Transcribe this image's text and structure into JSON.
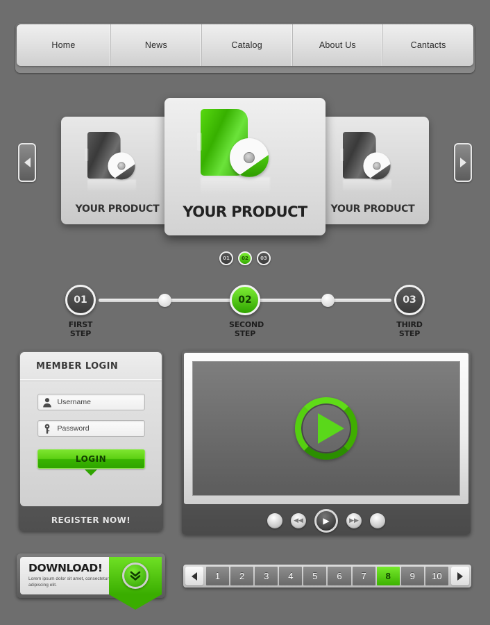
{
  "nav": {
    "items": [
      {
        "label": "Home",
        "active": true
      },
      {
        "label": "News",
        "active": false
      },
      {
        "label": "Catalog",
        "active": false
      },
      {
        "label": "About Us",
        "active": false
      },
      {
        "label": "Cantacts",
        "active": false
      }
    ]
  },
  "carousel": {
    "prev_icon": "left-arrow-icon",
    "next_icon": "right-arrow-icon",
    "slides": [
      {
        "label": "YOUR PRODUCT",
        "variant": "grey"
      },
      {
        "label": "YOUR PRODUCT",
        "variant": "green"
      },
      {
        "label": "YOUR PRODUCT",
        "variant": "grey"
      }
    ],
    "dots": [
      {
        "label": "01",
        "active": false
      },
      {
        "label": "02",
        "active": true
      },
      {
        "label": "03",
        "active": false
      }
    ]
  },
  "steps": [
    {
      "number": "01",
      "label": "FIRST STEP",
      "active": false
    },
    {
      "number": "02",
      "label": "SECOND STEP",
      "active": true
    },
    {
      "number": "03",
      "label": "THIRD STEP",
      "active": false
    }
  ],
  "login": {
    "title": "MEMBER LOGIN",
    "username": {
      "placeholder": "Username",
      "icon": "user-icon"
    },
    "password": {
      "placeholder": "Password",
      "icon": "key-icon"
    },
    "submit_label": "LOGIN",
    "register_label": "REGISTER NOW!"
  },
  "player": {
    "big_play_icon": "play-icon",
    "controls": [
      {
        "name": "stop-button",
        "glyph": ""
      },
      {
        "name": "rewind-button",
        "glyph": "◀◀"
      },
      {
        "name": "play-button",
        "glyph": "▶"
      },
      {
        "name": "forward-button",
        "glyph": "▶▶"
      },
      {
        "name": "eject-button",
        "glyph": ""
      }
    ]
  },
  "download": {
    "title": "DOWNLOAD!",
    "subtitle": "Lorem ipsum dolor sit amet, consectetur adipiscing elit.",
    "badge_icon": "double-chevron-down-icon"
  },
  "pagination": {
    "prev_icon": "left-arrow-icon",
    "next_icon": "right-arrow-icon",
    "pages": [
      "1",
      "2",
      "3",
      "4",
      "5",
      "6",
      "7",
      "8",
      "9",
      "10"
    ],
    "active_page": "8"
  },
  "colors": {
    "background": "#6e6e6e",
    "accent_green": "#4ecb12",
    "accent_green_light": "#7ced33",
    "accent_green_dark": "#2f9c00",
    "panel_light": "#e8e8e8",
    "panel_dark": "#4f4f4f"
  }
}
